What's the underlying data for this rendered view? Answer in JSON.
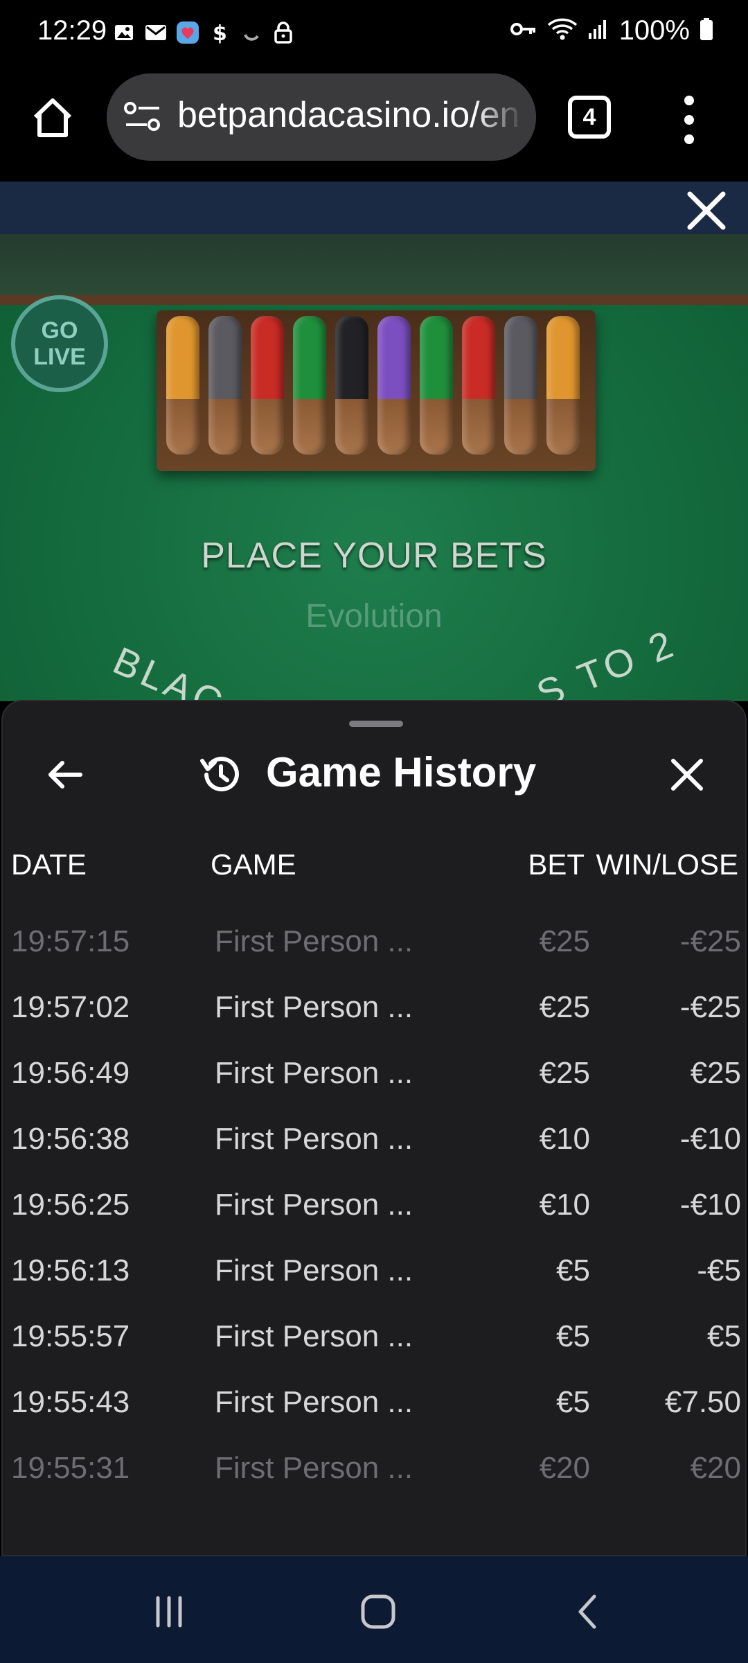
{
  "status_bar": {
    "time": "12:29",
    "battery": "100%",
    "icons_left": [
      "image-icon",
      "mail-icon",
      "heart-app-icon",
      "dollar-icon",
      "loading-icon",
      "lock-icon"
    ],
    "icons_right": [
      "key-icon",
      "wifi-icon",
      "signal-icon",
      "battery-icon"
    ]
  },
  "browser": {
    "url": "betpandacasino.io/en",
    "tab_count": "4"
  },
  "game": {
    "go_live_line1": "GO",
    "go_live_line2": "LIVE",
    "place_bets": "PLACE YOUR BETS",
    "provider": "Evolution",
    "arc_left": "BLAC",
    "arc_right": "S TO 2"
  },
  "history": {
    "title": "Game History",
    "columns": {
      "date": "DATE",
      "game": "GAME",
      "bet": "BET",
      "win": "WIN/LOSE"
    },
    "rows": [
      {
        "date": "19:57:15",
        "game": "First Person ...",
        "bet": "€25",
        "win": "-€25",
        "dim": true
      },
      {
        "date": "19:57:02",
        "game": "First Person ...",
        "bet": "€25",
        "win": "-€25",
        "dim": false
      },
      {
        "date": "19:56:49",
        "game": "First Person ...",
        "bet": "€25",
        "win": "€25",
        "dim": false
      },
      {
        "date": "19:56:38",
        "game": "First Person ...",
        "bet": "€10",
        "win": "-€10",
        "dim": false
      },
      {
        "date": "19:56:25",
        "game": "First Person ...",
        "bet": "€10",
        "win": "-€10",
        "dim": false
      },
      {
        "date": "19:56:13",
        "game": "First Person ...",
        "bet": "€5",
        "win": "-€5",
        "dim": false
      },
      {
        "date": "19:55:57",
        "game": "First Person ...",
        "bet": "€5",
        "win": "€5",
        "dim": false
      },
      {
        "date": "19:55:43",
        "game": "First Person ...",
        "bet": "€5",
        "win": "€7.50",
        "dim": false
      },
      {
        "date": "19:55:31",
        "game": "First Person ...",
        "bet": "€20",
        "win": "€20",
        "dim": true
      }
    ]
  },
  "chip_colors": [
    "#e0962e",
    "#5a5a60",
    "#c92b25",
    "#1f8f3c",
    "#222226",
    "#7c4fc0",
    "#1f8f3c",
    "#c92b25",
    "#5a5a60",
    "#e0962e"
  ]
}
